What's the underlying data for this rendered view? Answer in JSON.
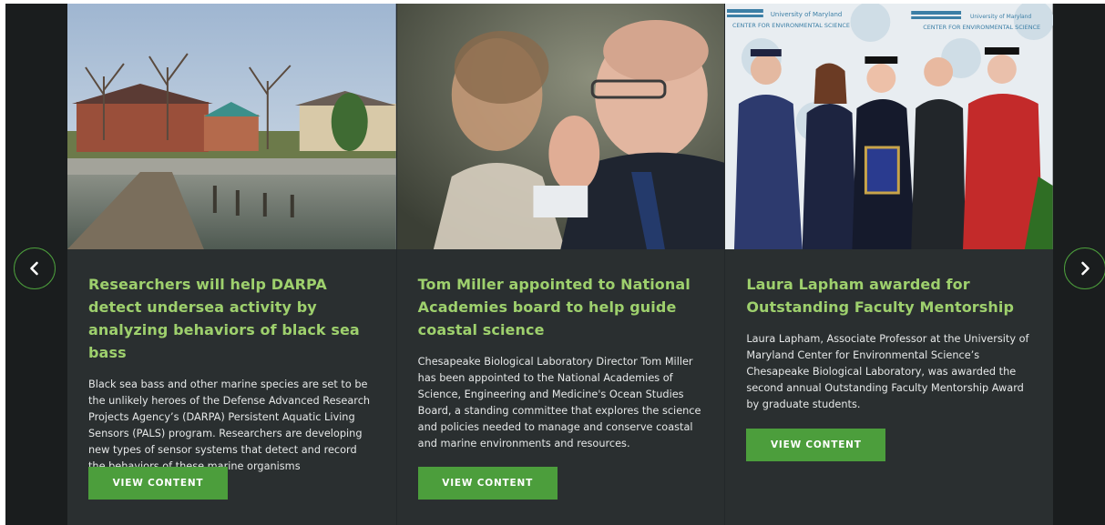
{
  "carousel": {
    "prev_icon": "chevron-left-icon",
    "next_icon": "chevron-right-icon",
    "accent_color": "#4c9e3c",
    "title_color": "#9ed06d",
    "cards": [
      {
        "image": "waterfront-dock-photo",
        "title": "Researchers will help DARPA detect undersea activity by analyzing behaviors of black sea bass",
        "description": "Black sea bass and other marine species are set to be the unlikely heroes of the Defense Advanced Research Projects Agency’s (DARPA) Persistent Aquatic Living Sensors (PALS) program. Researchers are developing new types of sensor systems that detect and record the behaviors of these marine organisms",
        "button_label": "VIEW CONTENT"
      },
      {
        "image": "men-listening-photo",
        "title": "Tom Miller appointed to National Academies board to help guide coastal science",
        "description": "Chesapeake Biological Laboratory Director Tom Miller has been appointed to the National Academies of Science, Engineering and Medicine's Ocean Studies Board, a standing committee that explores the science and policies needed to manage and conserve coastal and marine environments and resources.",
        "button_label": "VIEW CONTENT"
      },
      {
        "image": "graduation-group-photo",
        "title": "Laura Lapham awarded for Outstanding Faculty Mentorship",
        "description": "Laura Lapham, Associate Professor at the University of Maryland Center for Environmental Science’s Chesapeake Biological Laboratory, was awarded the second annual Outstanding Faculty Mentorship Award by graduate students.",
        "button_label": "VIEW CONTENT",
        "backdrop_text": [
          "University of Maryland",
          "CENTER FOR ENVIRONMENTAL SCIENCE"
        ]
      }
    ]
  }
}
